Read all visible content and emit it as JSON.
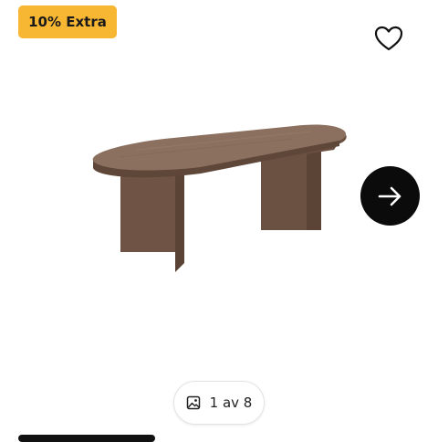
{
  "badge": {
    "label": "10% Extra"
  },
  "favorite": {
    "icon": "heart-outline-icon"
  },
  "product": {
    "image": "oval-coffee-table-walnut",
    "wood_color": "#7a6152"
  },
  "carousel": {
    "next_icon": "arrow-right-icon",
    "counter_icon": "gallery-icon",
    "counter_text": "1 av 8"
  },
  "colors": {
    "badge_bg": "#f7b733",
    "next_bg": "#0b0b0b"
  }
}
